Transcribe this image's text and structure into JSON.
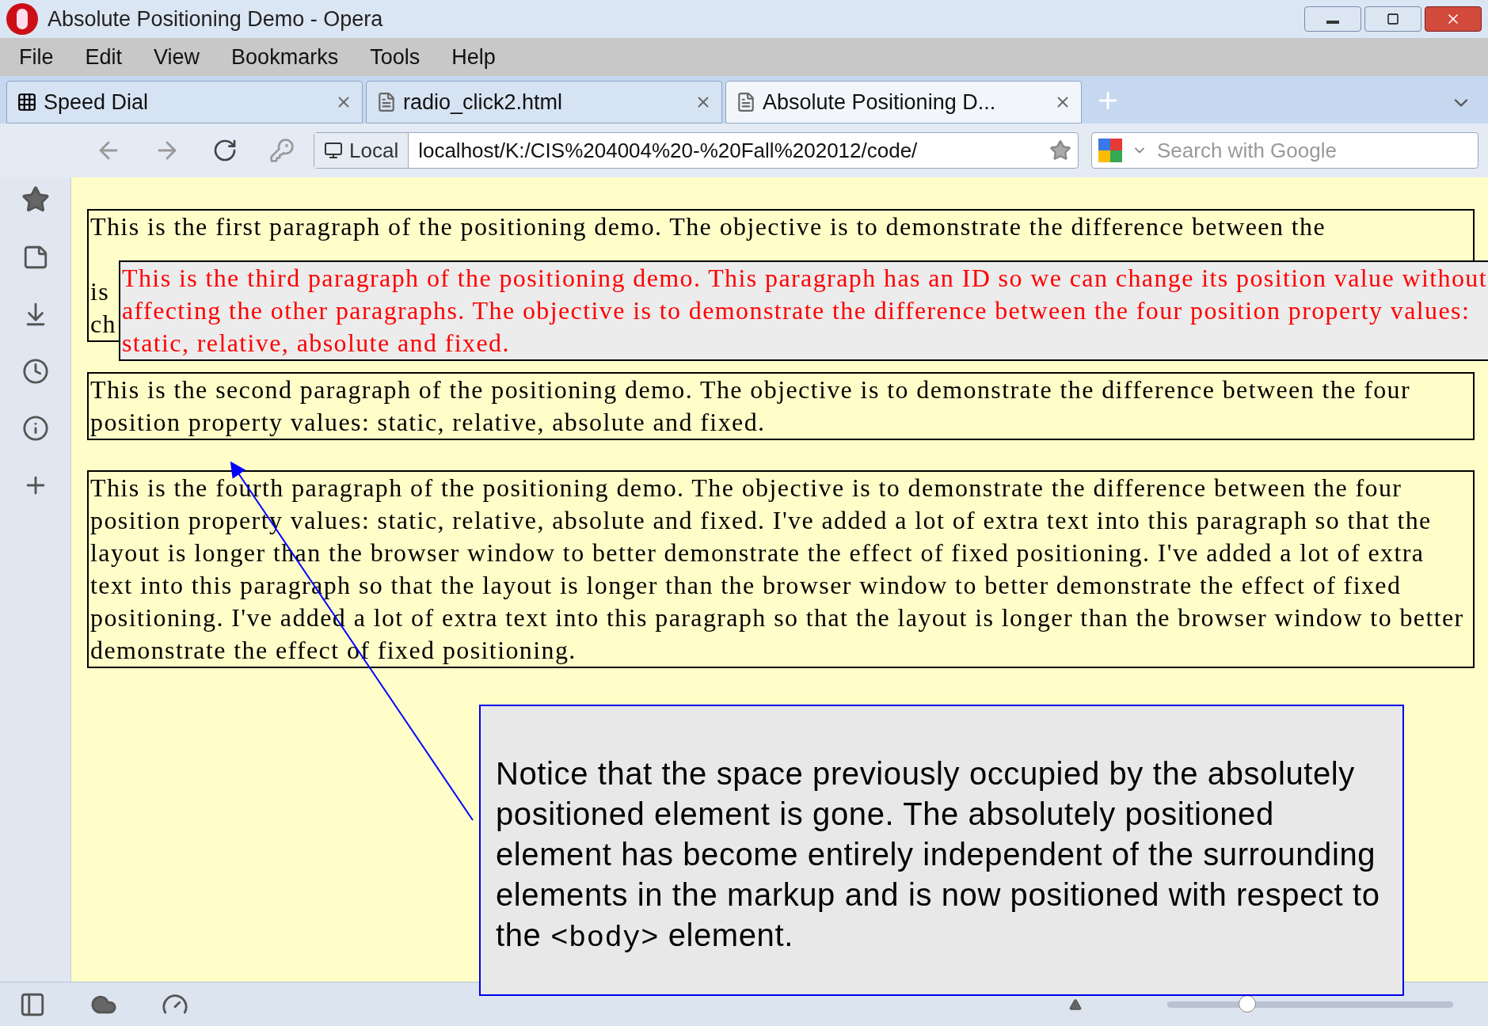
{
  "window": {
    "title": "Absolute Positioning Demo - Opera"
  },
  "menu": [
    "File",
    "Edit",
    "View",
    "Bookmarks",
    "Tools",
    "Help"
  ],
  "tabs": [
    {
      "label": "Speed Dial",
      "kind": "dial",
      "selected": false
    },
    {
      "label": "radio_click2.html",
      "kind": "page",
      "selected": false
    },
    {
      "label": "Absolute Positioning D...",
      "kind": "page",
      "selected": true
    }
  ],
  "address_bar": {
    "badge": "Local",
    "url": "localhost/K:/CIS%204004%20-%20Fall%202012/code/",
    "search_placeholder": "Search with Google"
  },
  "page": {
    "first_paragraph_lines": [
      "This is the first paragraph of the positioning demo. The objective is to demonstrate the difference between the",
      "is",
      "ch"
    ],
    "third_paragraph": "This is the third paragraph of the positioning demo. This paragraph has an ID so we can change its position value without affecting the other paragraphs. The objective is to demonstrate the difference between the four position property values: static, relative, absolute and fixed.",
    "second_paragraph": "This is the second paragraph of the positioning demo. The objective is to demonstrate the difference between the four position property values: static, relative, absolute and fixed.",
    "fourth_paragraph": "This is the fourth paragraph of the positioning demo. The objective is to demonstrate the difference between the four position property values: static, relative, absolute and fixed. I've added a lot of extra text into this paragraph so that the layout is longer than the browser window to better demonstrate the effect of fixed positioning. I've added a lot of extra text into this paragraph so that the layout is longer than the browser window to better demonstrate the effect of fixed positioning. I've added a lot of extra text into this paragraph so that the layout is longer than the browser window to better demonstrate the effect of fixed positioning."
  },
  "callout": {
    "text": "Notice that the space previously occupied by the absolutely positioned element is gone.  The absolutely positioned element has become entirely independent of the surrounding elements in the markup and is now positioned with respect to the",
    "code": "<body>",
    "text_end": "element."
  },
  "status_bar": {
    "zoom": {
      "level": 0.28
    }
  }
}
